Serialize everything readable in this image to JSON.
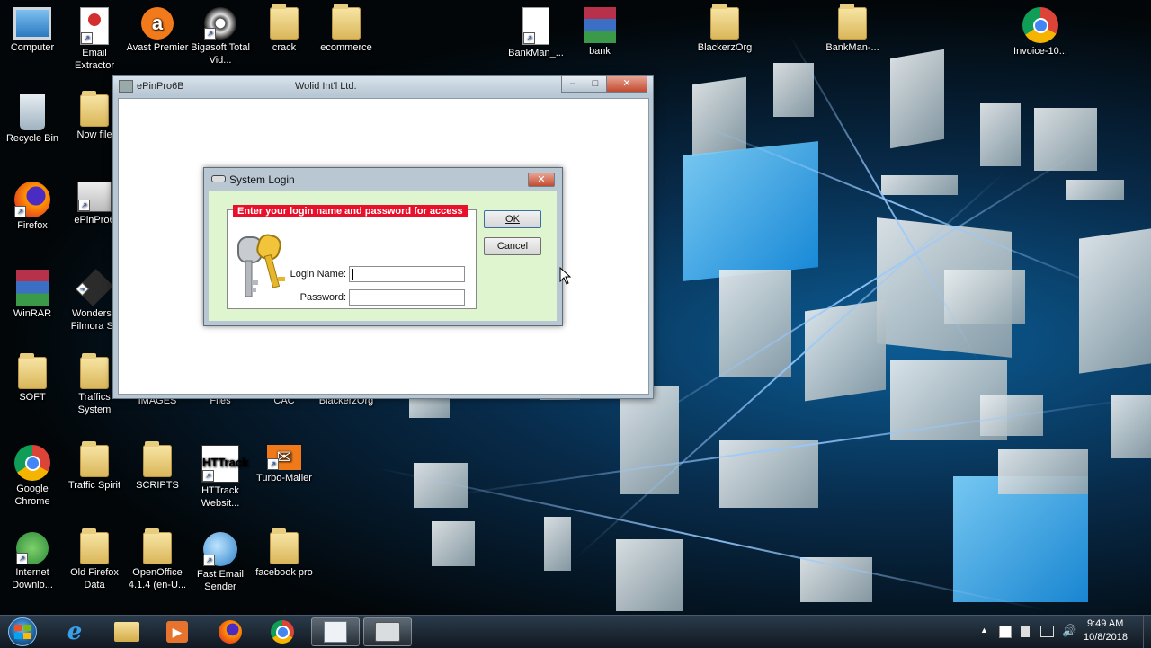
{
  "desktop": {
    "icons": [
      {
        "label": "Computer",
        "kind": "computer"
      },
      {
        "label": "Email Extractor",
        "kind": "mail"
      },
      {
        "label": "Avast Premier",
        "kind": "avast"
      },
      {
        "label": "Bigasoft Total Vid...",
        "kind": "reel"
      },
      {
        "label": "crack",
        "kind": "folder"
      },
      {
        "label": "ecommerce",
        "kind": "folder"
      },
      {
        "label": "BankMan_...",
        "kind": "doc"
      },
      {
        "label": "bank",
        "kind": "winrar"
      },
      {
        "label": "BlackerzOrg",
        "kind": "folder"
      },
      {
        "label": "BankMan-...",
        "kind": "folder"
      },
      {
        "label": "Invoice-10...",
        "kind": "chrome"
      },
      {
        "label": "Recycle Bin",
        "kind": "bin"
      },
      {
        "label": "Now file",
        "kind": "folder"
      },
      {
        "label": "Firefox",
        "kind": "firefox"
      },
      {
        "label": "ePinPro6",
        "kind": "printer"
      },
      {
        "label": "WinRAR",
        "kind": "winrar"
      },
      {
        "label": "Wondersh Filmora Sc",
        "kind": "filmora"
      },
      {
        "label": "SOFT",
        "kind": "folder"
      },
      {
        "label": "Traffics System",
        "kind": "folder"
      },
      {
        "label": "IMAGES",
        "kind": "hidden"
      },
      {
        "label": "Files",
        "kind": "hidden"
      },
      {
        "label": "CAC",
        "kind": "hidden"
      },
      {
        "label": "BlackerzOrg",
        "kind": "hidden"
      },
      {
        "label": "Google Chrome",
        "kind": "chrome"
      },
      {
        "label": "Traffic Spirit",
        "kind": "folder"
      },
      {
        "label": "SCRIPTS",
        "kind": "folder"
      },
      {
        "label": "HTTrack Websit...",
        "kind": "httrack"
      },
      {
        "label": "Turbo-Mailer",
        "kind": "turbomail"
      },
      {
        "label": "Internet Downlo...",
        "kind": "idm"
      },
      {
        "label": "Old Firefox Data",
        "kind": "folder"
      },
      {
        "label": "OpenOffice 4.1.4 (en-U...",
        "kind": "folder"
      },
      {
        "label": "Fast Email Sender",
        "kind": "globe"
      },
      {
        "label": "facebook pro",
        "kind": "folder"
      }
    ]
  },
  "app_window": {
    "title": "ePinPro6B",
    "subtitle": "Wolid Int'l Ltd.",
    "minimize": "–",
    "maximize": "□",
    "close": "✕"
  },
  "login_dialog": {
    "title": "System Login",
    "close": "✕",
    "banner": "Enter your login name and password for access",
    "login_label": "Login Name:",
    "password_label": "Password:",
    "login_value": "",
    "password_value": "",
    "ok_label": "OK",
    "cancel_label": "Cancel"
  },
  "taskbar": {
    "time": "9:49 AM",
    "date": "10/8/2018",
    "show_hidden": "▲"
  }
}
